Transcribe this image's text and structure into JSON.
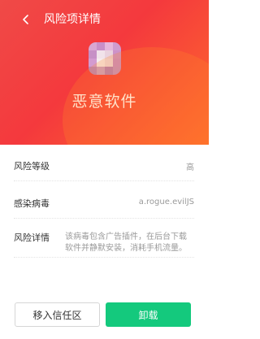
{
  "header": {
    "title": "风险项详情",
    "back_icon": "chevron-left-icon"
  },
  "app": {
    "name": "恶意软件",
    "icon": "blurred-app-icon"
  },
  "details": {
    "risk_level": {
      "label": "风险等级",
      "value": "高"
    },
    "virus": {
      "label": "感染病毒",
      "value": "a.rogue.evilJS"
    },
    "risk_detail": {
      "label": "风险详情",
      "value": "该病毒包含广告插件，在后台下载软件并静默安装，消耗手机流量。"
    }
  },
  "actions": {
    "trust_label": "移入信任区",
    "uninstall_label": "卸载"
  },
  "colors": {
    "hero_start": "#f04a47",
    "hero_end": "#ff6b2d",
    "uninstall_green": "#14c97d"
  }
}
